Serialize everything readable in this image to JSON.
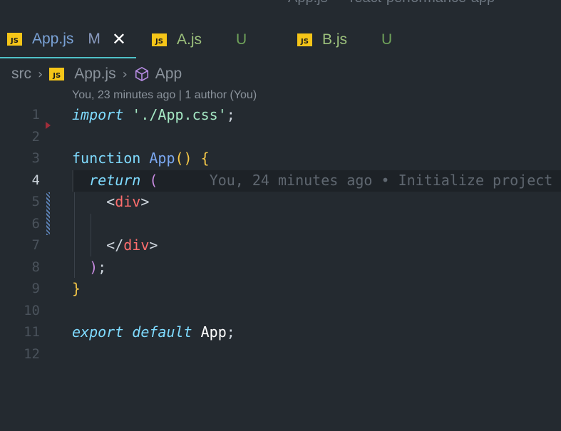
{
  "window": {
    "title": "App.js — react-performance-app"
  },
  "tabs": [
    {
      "icon": "JS",
      "name": "App.js",
      "status": "M",
      "close": "✕"
    },
    {
      "icon": "JS",
      "name": "A.js",
      "status": "U"
    },
    {
      "icon": "JS",
      "name": "B.js",
      "status": "U"
    }
  ],
  "breadcrumb": {
    "folder": "src",
    "file_icon": "JS",
    "file": "App.js",
    "symbol": "App"
  },
  "codelens": "You, 23 minutes ago | 1 author (You)",
  "lines": [
    {
      "num": "1",
      "t": {
        "a": "import",
        "b": " './App.css'",
        "c": ";"
      }
    },
    {
      "num": "2"
    },
    {
      "num": "3",
      "t": {
        "a": "function",
        "b": "App",
        "c": "()",
        "d": "{"
      }
    },
    {
      "num": "4",
      "t": {
        "a": "return",
        "b": "("
      },
      "blame": "You, 24 minutes ago • Initialize project"
    },
    {
      "num": "5",
      "t": {
        "a": "<",
        "b": "div",
        "c": ">"
      }
    },
    {
      "num": "6"
    },
    {
      "num": "7",
      "t": {
        "a": "</",
        "b": "div",
        "c": ">"
      }
    },
    {
      "num": "8",
      "t": {
        "a": ")",
        "b": ";"
      }
    },
    {
      "num": "9",
      "t": {
        "a": "}"
      }
    },
    {
      "num": "10"
    },
    {
      "num": "11",
      "t": {
        "a": "export default",
        "b": "App",
        "c": ";"
      }
    },
    {
      "num": "12"
    }
  ]
}
